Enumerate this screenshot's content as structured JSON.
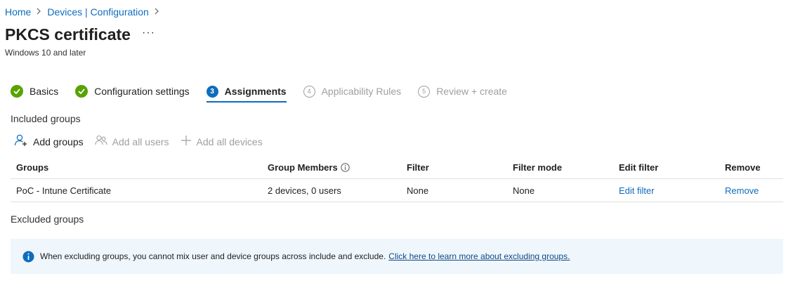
{
  "breadcrumb": {
    "items": [
      {
        "label": "Home"
      },
      {
        "label": "Devices | Configuration"
      }
    ],
    "separator": ">"
  },
  "header": {
    "title": "PKCS certificate",
    "more_label": "···",
    "subtitle": "Windows 10 and later"
  },
  "tabs": [
    {
      "label": "Basics",
      "state": "done"
    },
    {
      "label": "Configuration settings",
      "state": "done"
    },
    {
      "label": "Assignments",
      "state": "active",
      "number": "3"
    },
    {
      "label": "Applicability Rules",
      "state": "disabled",
      "number": "4"
    },
    {
      "label": "Review + create",
      "state": "disabled",
      "number": "5"
    }
  ],
  "included": {
    "title": "Included groups",
    "toolbar": {
      "add_groups": "Add groups",
      "add_all_users": "Add all users",
      "add_all_devices": "Add all devices"
    },
    "columns": {
      "groups": "Groups",
      "group_members": "Group Members",
      "filter": "Filter",
      "filter_mode": "Filter mode",
      "edit_filter": "Edit filter",
      "remove": "Remove"
    },
    "rows": [
      {
        "group": "PoC - Intune Certificate",
        "members": "2 devices, 0 users",
        "filter": "None",
        "filter_mode": "None",
        "edit_filter": "Edit filter",
        "remove": "Remove"
      }
    ]
  },
  "excluded": {
    "title": "Excluded groups",
    "info_text": "When excluding groups, you cannot mix user and device groups across include and exclude.",
    "info_link": "Click here to learn more about excluding groups."
  },
  "colors": {
    "accent": "#0f6cbd",
    "success": "#57a300",
    "disabled": "#a19f9d",
    "banner_bg": "#eff6fc"
  },
  "icons": {
    "check": "checkmark-circle-icon",
    "chevron": "chevron-right-icon",
    "add_person": "add-person-icon",
    "people": "people-icon",
    "plus": "plus-icon",
    "info": "info-icon"
  }
}
